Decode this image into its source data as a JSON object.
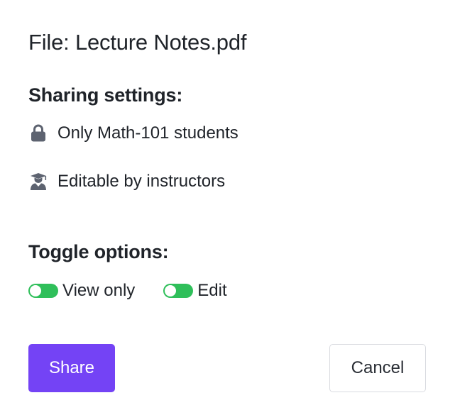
{
  "dialog": {
    "file_title": "File: Lecture Notes.pdf",
    "sharing_heading": "Sharing settings:",
    "settings": [
      {
        "icon": "lock-icon",
        "label": "Only Math-101 students"
      },
      {
        "icon": "instructor-icon",
        "label": "Editable by instructors"
      }
    ],
    "toggle_heading": "Toggle options:",
    "toggles": [
      {
        "label": "View only",
        "on": true
      },
      {
        "label": "Edit",
        "on": true
      }
    ],
    "buttons": {
      "share": "Share",
      "cancel": "Cancel"
    }
  },
  "colors": {
    "accent": "#7443f5",
    "toggle_on": "#2fbf5a",
    "icon": "#5d6370",
    "text": "#1f2329"
  }
}
